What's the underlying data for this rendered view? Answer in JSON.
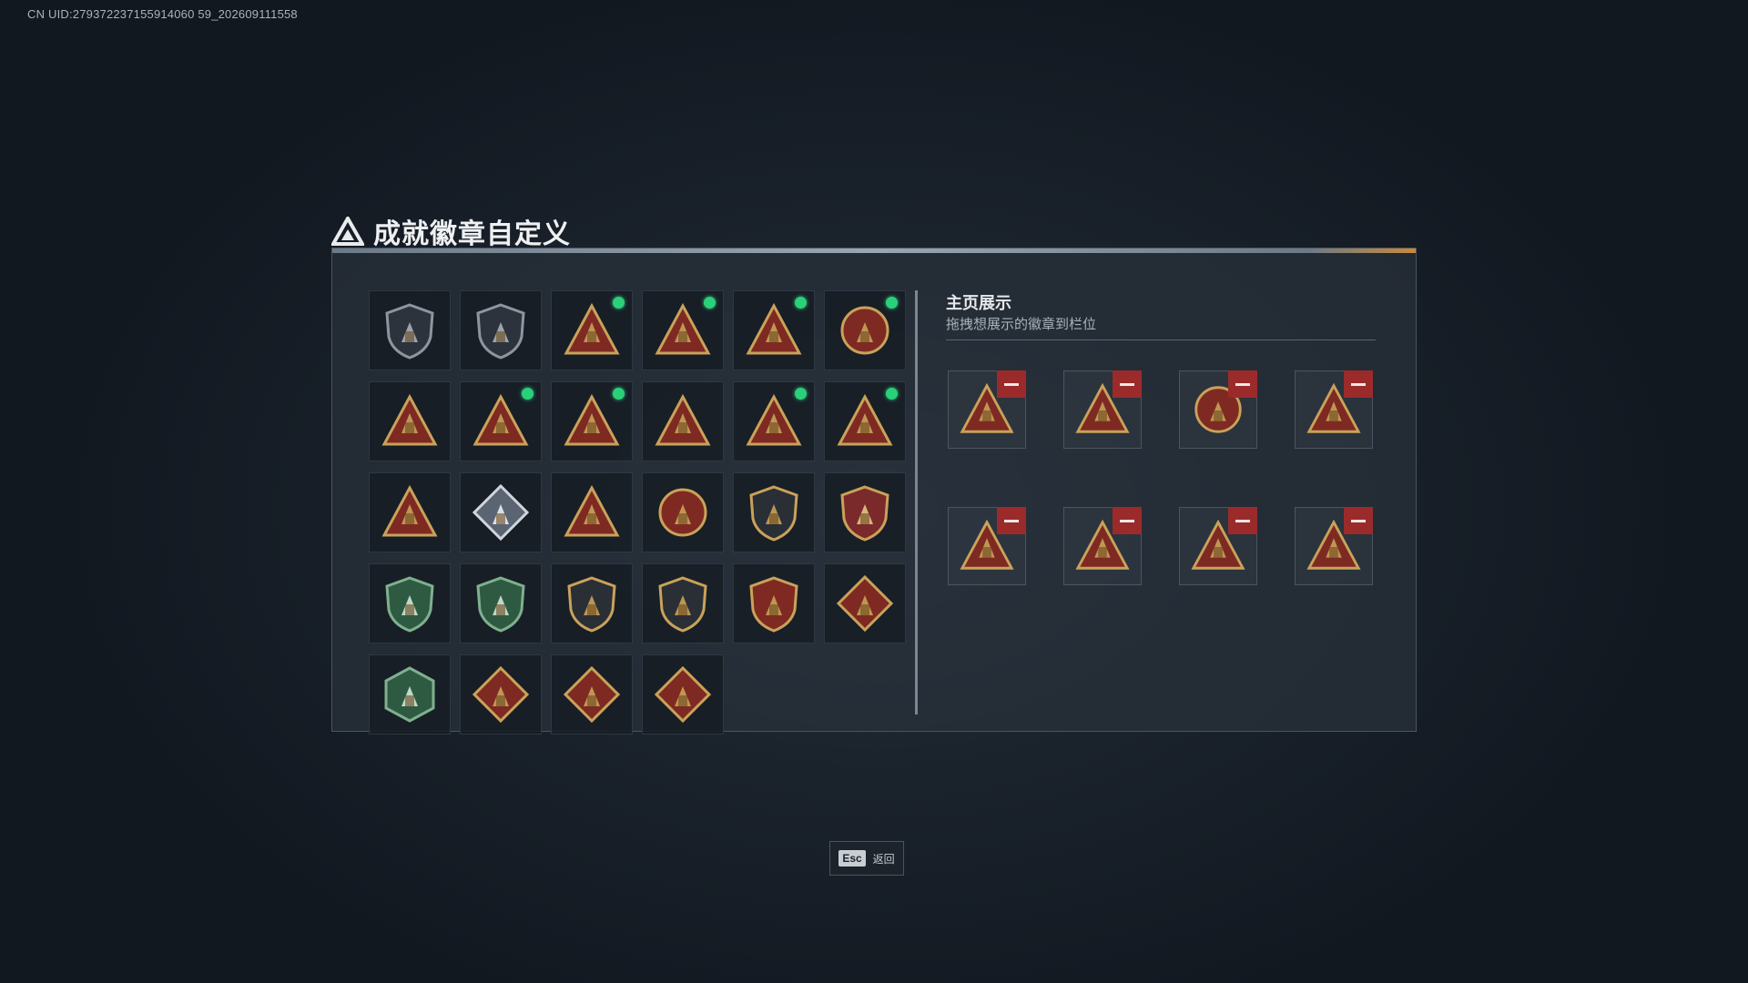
{
  "uid_text": "CN UID:279372237155914060 59_202609111558",
  "header": {
    "title": "成就徽章自定义"
  },
  "badges": [
    {
      "icon": "gray-triangle-shield-badge-icon",
      "indicator": false
    },
    {
      "icon": "gray-helicopter-shield-badge-icon",
      "indicator": false
    },
    {
      "icon": "gold-k1-triangle-badge-icon",
      "indicator": true
    },
    {
      "icon": "gold-58-triangle-badge-icon",
      "indicator": true
    },
    {
      "icon": "gold-59-winged-triangle-badge-icon",
      "indicator": true
    },
    {
      "icon": "gold-eagle-crest-badge-icon",
      "indicator": true
    },
    {
      "icon": "gold-hand-triangle-badge-icon",
      "indicator": false
    },
    {
      "icon": "gold-helmet-triangle-badge-icon",
      "indicator": true
    },
    {
      "icon": "gold-number-1-triangle-badge-icon",
      "indicator": true
    },
    {
      "icon": "gold-number-2-triangle-badge-icon",
      "indicator": false
    },
    {
      "icon": "gold-bag-triangle-badge-icon",
      "indicator": true
    },
    {
      "icon": "gold-wreath-triangle-badge-icon",
      "indicator": true
    },
    {
      "icon": "gold-soldiers-triangle-badge-icon",
      "indicator": false
    },
    {
      "icon": "silver-rose-diamond-badge-icon",
      "indicator": false
    },
    {
      "icon": "gold-rocket-triangle-badge-icon",
      "indicator": false
    },
    {
      "icon": "gold-star-compass-badge-icon",
      "indicator": false
    },
    {
      "icon": "dark-shield-emblem-badge-icon",
      "indicator": false
    },
    {
      "icon": "star-crest-shield-badge-icon",
      "indicator": false
    },
    {
      "icon": "green-lion-shield-badge-icon",
      "indicator": false
    },
    {
      "icon": "green-crosshair-shield-badge-icon",
      "indicator": false
    },
    {
      "icon": "dark-rifle-shield-badge-icon",
      "indicator": false
    },
    {
      "icon": "dark-slash-shield-badge-icon",
      "indicator": false
    },
    {
      "icon": "gold-anchor-shield-badge-icon",
      "indicator": false
    },
    {
      "icon": "red-wolf-diamond-badge-icon",
      "indicator": false
    },
    {
      "icon": "green-fox-hexagon-badge-icon",
      "indicator": false
    },
    {
      "icon": "red-dragon-diamond-badge-icon",
      "indicator": false
    },
    {
      "icon": "red-dragon-diamond-badge-icon",
      "indicator": false
    },
    {
      "icon": "red-runner-diamond-badge-icon",
      "indicator": false
    }
  ],
  "showcase": {
    "title": "主页展示",
    "subtitle": "拖拽想展示的徽章到栏位",
    "slots": [
      {
        "icon": "gold-bag-triangle-badge-icon"
      },
      {
        "icon": "gold-number-1-triangle-badge-icon"
      },
      {
        "icon": "gold-eagle-crest-badge-icon"
      },
      {
        "icon": "gold-59-winged-triangle-badge-icon"
      },
      {
        "icon": "gold-58-triangle-badge-icon"
      },
      {
        "icon": "gold-k1-triangle-badge-icon"
      },
      {
        "icon": "gold-wreath-triangle-badge-icon"
      },
      {
        "icon": "gold-helmet-triangle-badge-icon"
      }
    ]
  },
  "footer": {
    "esc_key": "Esc",
    "back_label": "返回"
  },
  "colors": {
    "gold": "#c9a25a",
    "gold_dark": "#6b4a1e",
    "red_fill": "#7e2a22",
    "indicator_green": "#2bd07a",
    "remove_red": "#9b2b2b"
  }
}
